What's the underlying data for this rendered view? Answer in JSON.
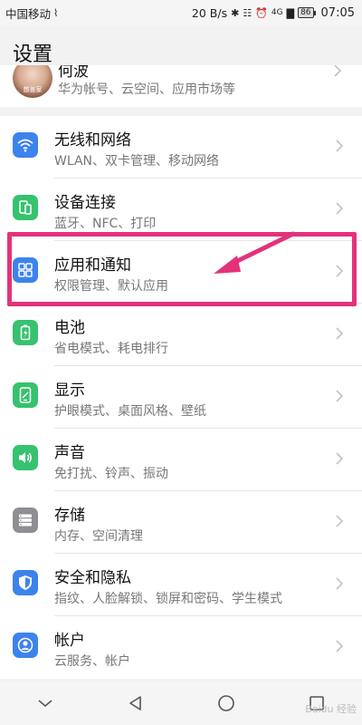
{
  "status_bar": {
    "carrier": "中国移动",
    "speed": "20 B/s",
    "signal": "4G",
    "battery": "86",
    "time": "07:05"
  },
  "page": {
    "title": "设置"
  },
  "account": {
    "name": "何波",
    "subtitle": "华为帐号、云空间、应用市场等",
    "avatar_caption": "慈善家"
  },
  "settings": [
    {
      "label": "无线和网络",
      "sub": "WLAN、双卡管理、移动网络",
      "icon": "wifi-icon",
      "color": "#3d83ee"
    },
    {
      "label": "设备连接",
      "sub": "蓝牙、NFC、打印",
      "icon": "device-connect-icon",
      "color": "#36c26e"
    },
    {
      "label": "应用和通知",
      "sub": "权限管理、默认应用",
      "icon": "apps-grid-icon",
      "color": "#3d83ee"
    },
    {
      "label": "电池",
      "sub": "省电模式、耗电排行",
      "icon": "battery-icon",
      "color": "#36c26e"
    },
    {
      "label": "显示",
      "sub": "护眼模式、桌面风格、壁纸",
      "icon": "display-icon",
      "color": "#36c26e"
    },
    {
      "label": "声音",
      "sub": "免打扰、铃声、振动",
      "icon": "sound-icon",
      "color": "#36c26e"
    },
    {
      "label": "存储",
      "sub": "内存、空间清理",
      "icon": "storage-icon",
      "color": "#8e8e93"
    },
    {
      "label": "安全和隐私",
      "sub": "指纹、人脸解锁、锁屏和密码、学生模式",
      "icon": "shield-icon",
      "color": "#3d83ee"
    },
    {
      "label": "帐户",
      "sub": "云服务、帐户",
      "icon": "account-icon",
      "color": "#3d83ee"
    }
  ],
  "annotation": {
    "highlight_color": "#e3327a"
  },
  "navbar": {
    "buttons": [
      "chevron-down-icon",
      "back-icon",
      "home-icon",
      "recents-icon"
    ]
  },
  "watermark": "Baidu 经验"
}
